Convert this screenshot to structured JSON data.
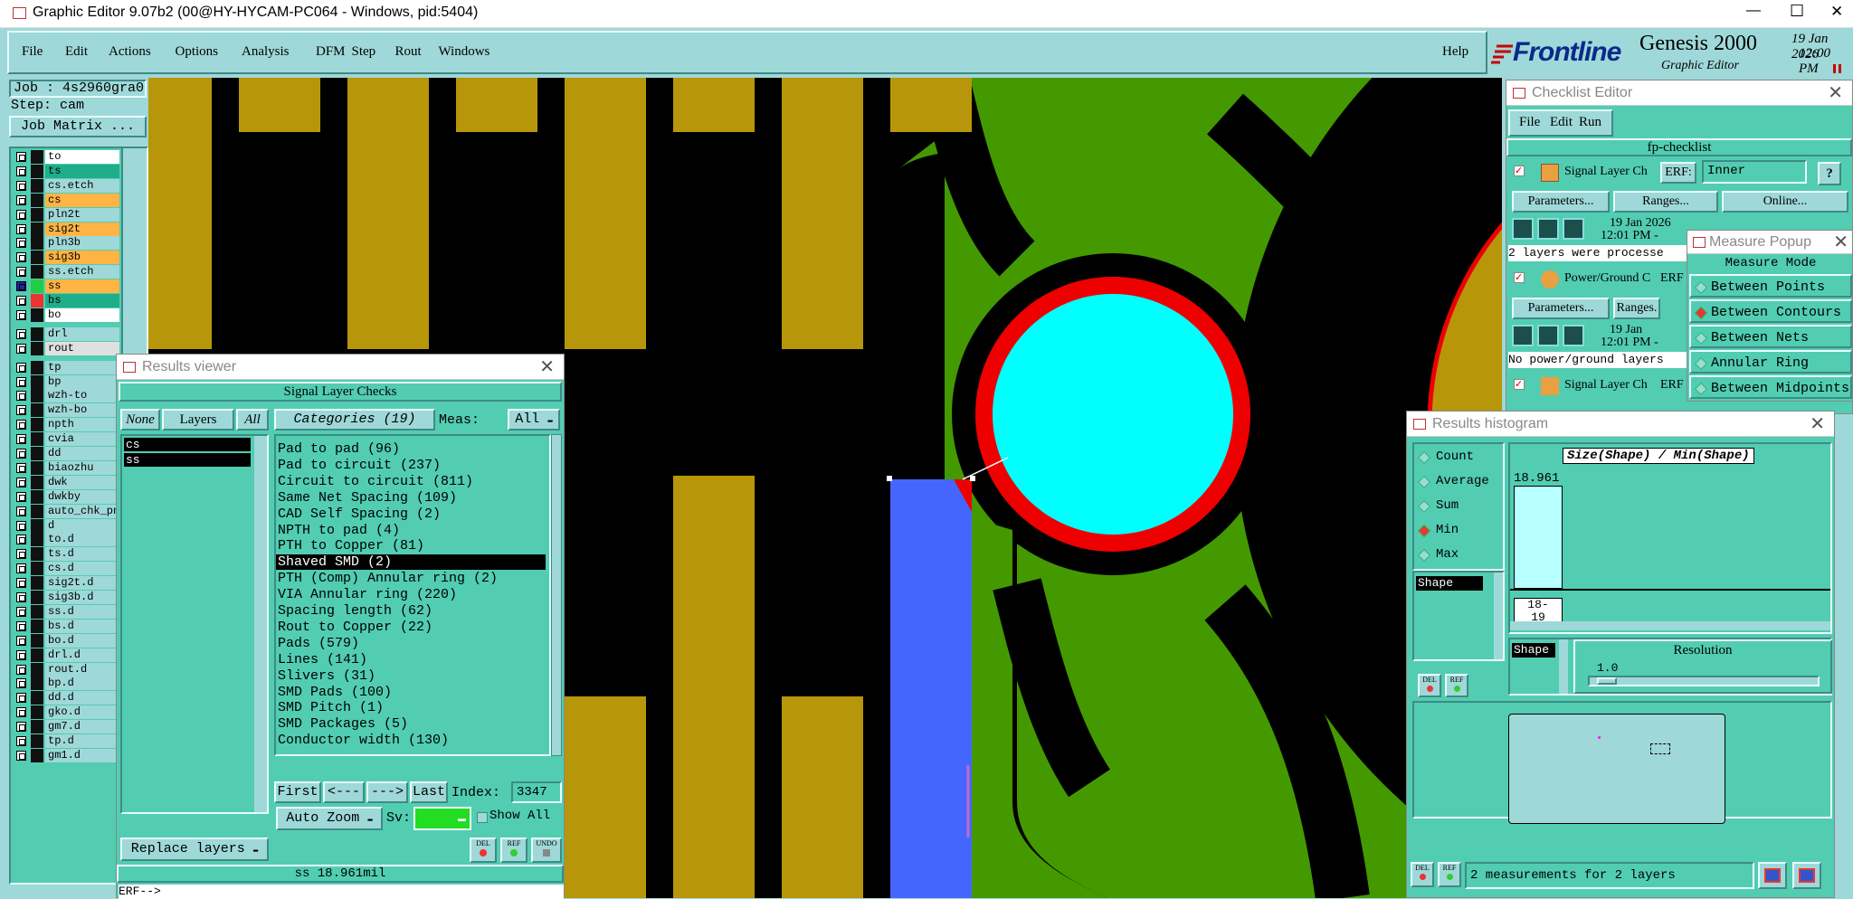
{
  "window": {
    "title": "Graphic Editor 9.07b2 (00@HY-HYCAM-PC064 - Windows, pid:5404)",
    "minimize": "—",
    "maximize": "☐",
    "close": "✕"
  },
  "menu": {
    "items": [
      "File",
      "Edit",
      "Actions",
      "Options",
      "Analysis",
      "DFM",
      "Step",
      "Rout",
      "Windows"
    ],
    "help": "Help"
  },
  "brand": {
    "logo": "Frontline",
    "product": "Genesis 2000",
    "subtitle": "Graphic Editor",
    "date": "19 Jan 2026",
    "time": "12:00 PM"
  },
  "job": {
    "job_label": "Job : 4s2960gra0",
    "step_label": "Step: cam",
    "matrix_button": "Job Matrix ..."
  },
  "layers": [
    {
      "name": "to",
      "color": "#ffffff"
    },
    {
      "name": "ts",
      "color": "#1fae8a"
    },
    {
      "name": "cs.etch",
      "color": "#9fd8d8"
    },
    {
      "name": "cs",
      "color": "#ffb444"
    },
    {
      "name": "pln2t",
      "color": "#9fd8d8"
    },
    {
      "name": "sig2t",
      "color": "#ffb444"
    },
    {
      "name": "pln3b",
      "color": "#9fd8d8"
    },
    {
      "name": "sig3b",
      "color": "#ffb444"
    },
    {
      "name": "ss.etch",
      "color": "#9fd8d8"
    },
    {
      "name": "ss",
      "color": "#ffb444"
    },
    {
      "name": "bs",
      "color": "#1fae8a"
    },
    {
      "name": "bo",
      "color": "#ffffff"
    },
    {
      "name": "drl",
      "color": "#9fd8d8"
    },
    {
      "name": "rout",
      "color": "#e0e0e0"
    },
    {
      "name": "tp",
      "color": "#9fd8d8"
    },
    {
      "name": "bp",
      "color": "#9fd8d8"
    },
    {
      "name": "wzh-to",
      "color": "#9fd8d8"
    },
    {
      "name": "wzh-bo",
      "color": "#9fd8d8"
    },
    {
      "name": "npth",
      "color": "#9fd8d8"
    },
    {
      "name": "cvia",
      "color": "#9fd8d8"
    },
    {
      "name": "dd",
      "color": "#9fd8d8"
    },
    {
      "name": "biaozhu",
      "color": "#9fd8d8"
    },
    {
      "name": "dwk",
      "color": "#9fd8d8"
    },
    {
      "name": "dwkby",
      "color": "#9fd8d8"
    },
    {
      "name": "auto_chk_pn",
      "color": "#9fd8d8"
    },
    {
      "name": "d",
      "color": "#9fd8d8"
    },
    {
      "name": "to.d",
      "color": "#9fd8d8"
    },
    {
      "name": "ts.d",
      "color": "#9fd8d8"
    },
    {
      "name": "cs.d",
      "color": "#9fd8d8"
    },
    {
      "name": "sig2t.d",
      "color": "#9fd8d8"
    },
    {
      "name": "sig3b.d",
      "color": "#9fd8d8"
    },
    {
      "name": "ss.d",
      "color": "#9fd8d8"
    },
    {
      "name": "bs.d",
      "color": "#9fd8d8"
    },
    {
      "name": "bo.d",
      "color": "#9fd8d8"
    },
    {
      "name": "drl.d",
      "color": "#9fd8d8"
    },
    {
      "name": "rout.d",
      "color": "#9fd8d8"
    },
    {
      "name": "bp.d",
      "color": "#9fd8d8"
    },
    {
      "name": "dd.d",
      "color": "#9fd8d8"
    },
    {
      "name": "gko.d",
      "color": "#9fd8d8"
    },
    {
      "name": "gm7.d",
      "color": "#9fd8d8"
    },
    {
      "name": "tp.d",
      "color": "#9fd8d8"
    },
    {
      "name": "gm1.d",
      "color": "#9fd8d8"
    }
  ],
  "results_viewer": {
    "title": "Results viewer",
    "header": "Signal Layer Checks",
    "none": "None",
    "layers": "Layers",
    "all": "All",
    "layer_list": [
      "cs",
      "ss"
    ],
    "categories_label": "Categories (19)",
    "meas_label": "Meas:",
    "meas_value": "All",
    "categories": [
      "Pad to pad (96)",
      "Pad to circuit (237)",
      "Circuit to circuit (811)",
      "Same Net Spacing (109)",
      "CAD Self Spacing (2)",
      "NPTH to pad (4)",
      "PTH to Copper (81)",
      "Shaved SMD (2)",
      "PTH (Comp) Annular ring (2)",
      "VIA Annular ring (220)",
      "Spacing length (62)",
      "Rout to Copper (22)",
      "Pads (579)",
      "Lines (141)",
      "Slivers (31)",
      "SMD Pads (100)",
      "SMD Pitch (1)",
      "SMD Packages (5)",
      "Conductor width (130)"
    ],
    "first": "First",
    "prev": "<---",
    "next": "--->",
    "last": "Last",
    "index_label": "Index:",
    "index_value": "3347",
    "auto_zoom": "Auto Zoom",
    "sv": "Sv:",
    "show_all": "Show All",
    "replace_layers": "Replace layers",
    "status": "ss 18.961mil",
    "erf": "ERF-->",
    "del": "DEL",
    "ref": "REF",
    "undo": "UNDO"
  },
  "checklist": {
    "title": "Checklist Editor",
    "menu": [
      "File",
      "Edit",
      "Run"
    ],
    "name": "fp-checklist",
    "row1_label": "Signal Layer Ch",
    "erf": "ERF:",
    "erf_value": "Inner",
    "help": "?",
    "parameters": "Parameters...",
    "ranges": "Ranges...",
    "online": "Online...",
    "date1": "19 Jan 2026",
    "time1": "12:01 PM -",
    "msg1": "2 layers were processe",
    "row2_label": "Power/Ground C",
    "erf2": "ERF",
    "parameters2": "Parameters...",
    "ranges2": "Ranges.",
    "date2": "19 Jan",
    "time2": "12:01 PM -",
    "msg2": "No power/ground layers",
    "row3_label": "Signal Layer Ch",
    "erf3": "ERF"
  },
  "measure": {
    "title": "Measure Popup",
    "header": "Measure Mode",
    "modes": [
      "Between Points",
      "Between Contours",
      "Between Nets",
      "Annular Ring",
      "Between Midpoints"
    ],
    "selected": 1
  },
  "histogram": {
    "title": "Results histogram",
    "stats": [
      "Count",
      "Average",
      "Sum",
      "Min",
      "Max"
    ],
    "selected_stat": 3,
    "chart_title": "Size(Shape) / Min(Shape)",
    "bar_value": "18.961",
    "bin_label_a": "18-",
    "bin_label_b": "19",
    "list_item": "Shape",
    "list_item2": "Shape",
    "resolution_label": "Resolution",
    "resolution_value": "1.0",
    "status": "2 measurements for 2 layers",
    "del": "DEL",
    "ref": "REF"
  }
}
